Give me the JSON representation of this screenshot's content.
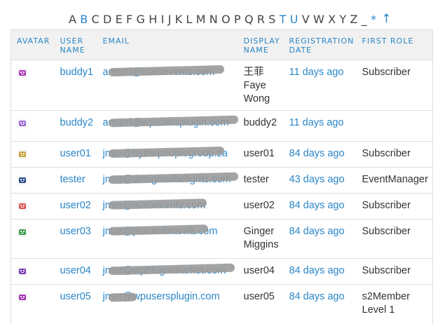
{
  "alphabet": {
    "letters": [
      {
        "l": "A",
        "active": false
      },
      {
        "l": "B",
        "active": true
      },
      {
        "l": "C",
        "active": false
      },
      {
        "l": "D",
        "active": false
      },
      {
        "l": "E",
        "active": false
      },
      {
        "l": "F",
        "active": false
      },
      {
        "l": "G",
        "active": false
      },
      {
        "l": "H",
        "active": false
      },
      {
        "l": "I",
        "active": false
      },
      {
        "l": "J",
        "active": false
      },
      {
        "l": "K",
        "active": false
      },
      {
        "l": "L",
        "active": false
      },
      {
        "l": "M",
        "active": false
      },
      {
        "l": "N",
        "active": false
      },
      {
        "l": "O",
        "active": false
      },
      {
        "l": "P",
        "active": false
      },
      {
        "l": "Q",
        "active": false
      },
      {
        "l": "R",
        "active": false
      },
      {
        "l": "S",
        "active": false
      },
      {
        "l": "T",
        "active": true
      },
      {
        "l": "U",
        "active": true
      },
      {
        "l": "V",
        "active": false
      },
      {
        "l": "W",
        "active": false
      },
      {
        "l": "X",
        "active": false
      },
      {
        "l": "Y",
        "active": false
      },
      {
        "l": "Z",
        "active": false
      },
      {
        "l": "_",
        "active": false
      },
      {
        "l": "*",
        "active": true
      }
    ],
    "up_arrow": "↑"
  },
  "columns": {
    "avatar": "Avatar",
    "user_name": "User Name",
    "email": "Email",
    "display_name": "Display Name",
    "registration_date": "Registration Date",
    "first_role": "First Role"
  },
  "rows": [
    {
      "user": "buddy1",
      "email": "amarri@isaloevents.com",
      "display": [
        "王菲",
        "Faye",
        "Wong"
      ],
      "date": "11 days ago",
      "role": [
        "Subscriber"
      ],
      "avatar_color": "#b03bb8"
    },
    {
      "user": "buddy2",
      "email": "amarri@wpusersplugin.com",
      "display": [
        "buddy2"
      ],
      "date": "11 days ago",
      "role": [],
      "avatar_color": "#9c6bd6"
    },
    {
      "user": "user01",
      "email": "jmar@bythepeoplegroup.za",
      "display": [
        "user01"
      ],
      "date": "84 days ago",
      "role": [
        "Subscriber"
      ],
      "avatar_color": "#c9a13c"
    },
    {
      "user": "tester",
      "email": "jmar@designeddelights.com",
      "display": [
        "tester"
      ],
      "date": "43 days ago",
      "role": [
        "EventManager"
      ],
      "avatar_color": "#2f4f8f"
    },
    {
      "user": "user02",
      "email": "jmar@isaloevents.com",
      "display": [
        "user02"
      ],
      "date": "84 days ago",
      "role": [
        "Subscriber"
      ],
      "avatar_color": "#d9534f"
    },
    {
      "user": "user03",
      "email": "jmar@pulseofmanila.com",
      "display": [
        "Ginger",
        "Miggins"
      ],
      "date": "84 days ago",
      "role": [
        "Subscriber"
      ],
      "avatar_color": "#3c9c4a"
    },
    {
      "user": "user04",
      "email": "jmar@wpbluginmarket.com",
      "display": [
        "user04"
      ],
      "date": "84 days ago",
      "role": [
        "Subscriber"
      ],
      "avatar_color": "#7a3cb8"
    },
    {
      "user": "user05",
      "email": "jmar@wpusersplugin.com",
      "display": [
        "user05"
      ],
      "date": "84 days ago",
      "role": [
        "s2Member",
        "Level 1"
      ],
      "avatar_color": "#a23ab0"
    }
  ],
  "colors": {
    "link": "#2a86c7",
    "header_bg": "#f1f1f1",
    "border": "#dddddd"
  }
}
